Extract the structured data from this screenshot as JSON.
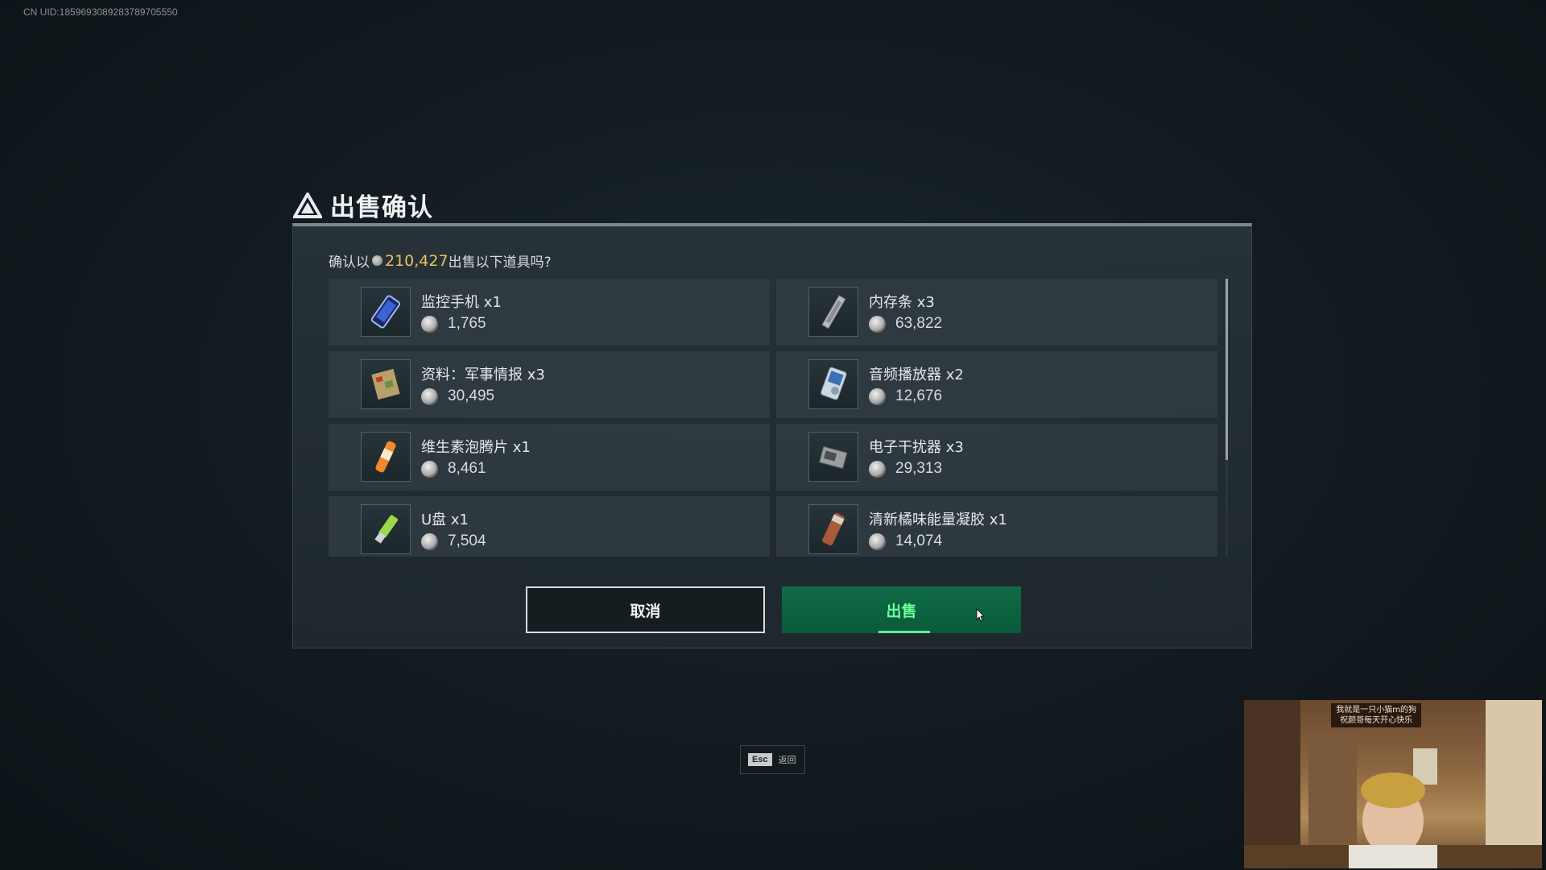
{
  "uid_text": "CN UID:1859693089283789705550",
  "dialog": {
    "title": "出售确认",
    "prompt_prefix": "确认以",
    "total": "210,427",
    "prompt_suffix": "出售以下道具吗?"
  },
  "items": [
    {
      "name": "监控手机 x1",
      "price": "1,765",
      "icon": "phone-icon"
    },
    {
      "name": "内存条 x3",
      "price": "63,822",
      "icon": "memory-stick-icon"
    },
    {
      "name": "资料：军事情报 x3",
      "price": "30,495",
      "icon": "document-icon"
    },
    {
      "name": "音频播放器 x2",
      "price": "12,676",
      "icon": "audio-player-icon"
    },
    {
      "name": "维生素泡腾片 x1",
      "price": "8,461",
      "icon": "vitamin-tube-icon"
    },
    {
      "name": "电子干扰器 x3",
      "price": "29,313",
      "icon": "jammer-icon"
    },
    {
      "name": "U盘 x1",
      "price": "7,504",
      "icon": "usb-drive-icon"
    },
    {
      "name": "清新橘味能量凝胶 x1",
      "price": "14,074",
      "icon": "energy-gel-icon"
    }
  ],
  "buttons": {
    "cancel": "取消",
    "sell": "出售"
  },
  "esc_hint": {
    "key": "Esc",
    "label": "返回"
  },
  "webcam": {
    "caption_line1": "我就是一只小猫m的狗",
    "caption_line2": "祝颜哥每天开心快乐"
  },
  "colors": {
    "accent_total": "#e7c45a",
    "sell_button": "#0f6b45",
    "sell_text": "#6dff9a"
  }
}
